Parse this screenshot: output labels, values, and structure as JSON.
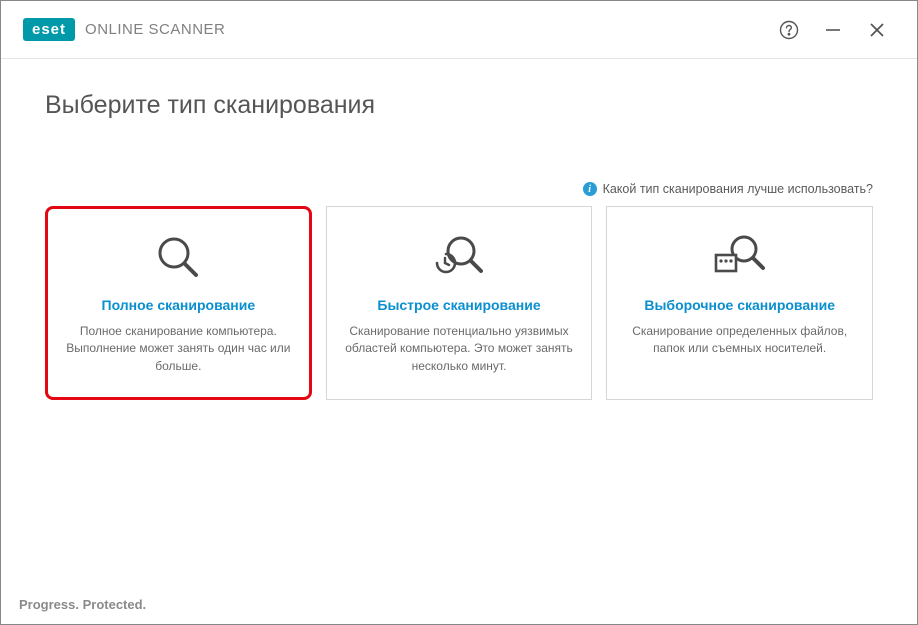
{
  "header": {
    "brand": "eset",
    "product": "ONLINE SCANNER"
  },
  "page": {
    "title": "Выберите тип сканирования"
  },
  "hint": {
    "text": "Какой тип сканирования лучше использовать?"
  },
  "cards": {
    "full": {
      "title": "Полное сканирование",
      "desc": "Полное сканирование компьютера. Выполнение может занять один час или больше."
    },
    "quick": {
      "title": "Быстрое сканирование",
      "desc": "Сканирование потенциально уязвимых областей компьютера. Это может занять несколько минут."
    },
    "custom": {
      "title": "Выборочное сканирование",
      "desc": "Сканирование определенных файлов, папок или съемных носителей."
    }
  },
  "footer": {
    "tagline": "Progress. Protected."
  }
}
